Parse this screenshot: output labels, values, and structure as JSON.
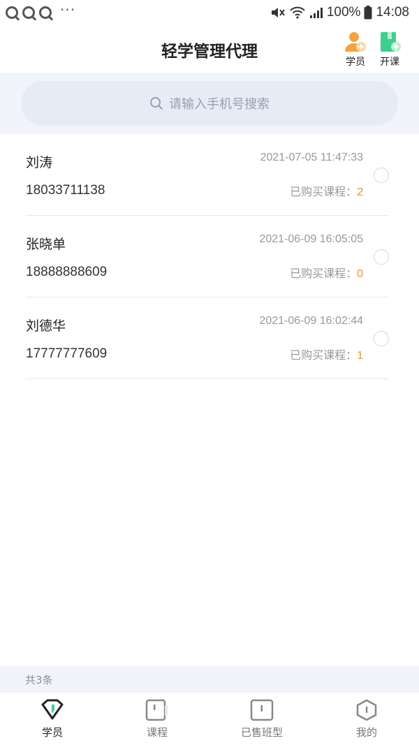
{
  "status_bar": {
    "battery": "100%",
    "time": "14:08"
  },
  "header": {
    "title": "轻学管理代理",
    "actions": [
      {
        "label": "学员",
        "icon": "add-user-icon"
      },
      {
        "label": "开课",
        "icon": "add-course-icon"
      }
    ]
  },
  "search": {
    "placeholder": "请输入手机号搜索"
  },
  "students": [
    {
      "name": "刘涛",
      "phone": "18033711138",
      "date": "2021-07-05 11:47:33",
      "courses_label": "已购买课程：",
      "courses_count": "2"
    },
    {
      "name": "张晓单",
      "phone": "18888888609",
      "date": "2021-06-09 16:05:05",
      "courses_label": "已购买课程：",
      "courses_count": "0"
    },
    {
      "name": "刘德华",
      "phone": "17777777609",
      "date": "2021-06-09 16:02:44",
      "courses_label": "已购买课程：",
      "courses_count": "1"
    }
  ],
  "summary": {
    "total": "共3条"
  },
  "tabs": [
    {
      "label": "学员",
      "icon": "student-tab-icon",
      "active": true
    },
    {
      "label": "课程",
      "icon": "course-tab-icon",
      "active": false
    },
    {
      "label": "已售班型",
      "icon": "sold-class-tab-icon",
      "active": false
    },
    {
      "label": "我的",
      "icon": "profile-tab-icon",
      "active": false
    }
  ],
  "colors": {
    "accent_green": "#3ecf8e",
    "accent_orange": "#f5a33a",
    "count_orange": "#e8912e",
    "section_bg": "#f1f4fb"
  }
}
